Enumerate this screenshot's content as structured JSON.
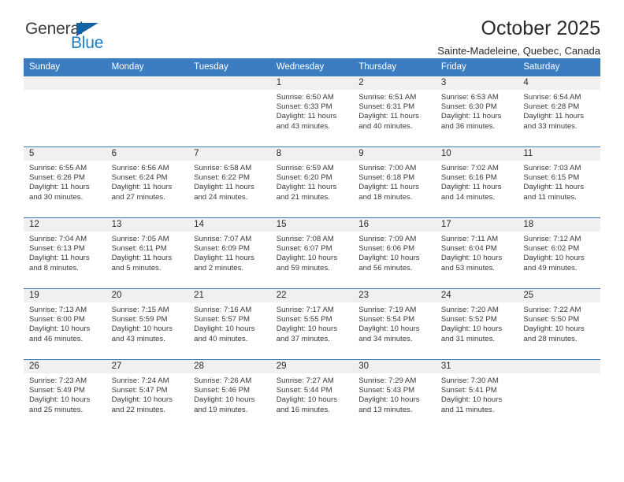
{
  "brand": {
    "name_part1": "General",
    "name_part2": "Blue",
    "color_dark": "#3d3d3d",
    "color_blue": "#1f7dc4"
  },
  "header": {
    "title": "October 2025",
    "subtitle": "Sainte-Madeleine, Quebec, Canada",
    "accent_color": "#3b7dc0"
  },
  "calendar": {
    "weekday_headers": [
      "Sunday",
      "Monday",
      "Tuesday",
      "Wednesday",
      "Thursday",
      "Friday",
      "Saturday"
    ],
    "weeks": [
      [
        {
          "day": "",
          "empty": true
        },
        {
          "day": "",
          "empty": true
        },
        {
          "day": "",
          "empty": true
        },
        {
          "day": "1",
          "sunrise": "Sunrise: 6:50 AM",
          "sunset": "Sunset: 6:33 PM",
          "daylight": "Daylight: 11 hours and 43 minutes."
        },
        {
          "day": "2",
          "sunrise": "Sunrise: 6:51 AM",
          "sunset": "Sunset: 6:31 PM",
          "daylight": "Daylight: 11 hours and 40 minutes."
        },
        {
          "day": "3",
          "sunrise": "Sunrise: 6:53 AM",
          "sunset": "Sunset: 6:30 PM",
          "daylight": "Daylight: 11 hours and 36 minutes."
        },
        {
          "day": "4",
          "sunrise": "Sunrise: 6:54 AM",
          "sunset": "Sunset: 6:28 PM",
          "daylight": "Daylight: 11 hours and 33 minutes."
        }
      ],
      [
        {
          "day": "5",
          "sunrise": "Sunrise: 6:55 AM",
          "sunset": "Sunset: 6:26 PM",
          "daylight": "Daylight: 11 hours and 30 minutes."
        },
        {
          "day": "6",
          "sunrise": "Sunrise: 6:56 AM",
          "sunset": "Sunset: 6:24 PM",
          "daylight": "Daylight: 11 hours and 27 minutes."
        },
        {
          "day": "7",
          "sunrise": "Sunrise: 6:58 AM",
          "sunset": "Sunset: 6:22 PM",
          "daylight": "Daylight: 11 hours and 24 minutes."
        },
        {
          "day": "8",
          "sunrise": "Sunrise: 6:59 AM",
          "sunset": "Sunset: 6:20 PM",
          "daylight": "Daylight: 11 hours and 21 minutes."
        },
        {
          "day": "9",
          "sunrise": "Sunrise: 7:00 AM",
          "sunset": "Sunset: 6:18 PM",
          "daylight": "Daylight: 11 hours and 18 minutes."
        },
        {
          "day": "10",
          "sunrise": "Sunrise: 7:02 AM",
          "sunset": "Sunset: 6:16 PM",
          "daylight": "Daylight: 11 hours and 14 minutes."
        },
        {
          "day": "11",
          "sunrise": "Sunrise: 7:03 AM",
          "sunset": "Sunset: 6:15 PM",
          "daylight": "Daylight: 11 hours and 11 minutes."
        }
      ],
      [
        {
          "day": "12",
          "sunrise": "Sunrise: 7:04 AM",
          "sunset": "Sunset: 6:13 PM",
          "daylight": "Daylight: 11 hours and 8 minutes."
        },
        {
          "day": "13",
          "sunrise": "Sunrise: 7:05 AM",
          "sunset": "Sunset: 6:11 PM",
          "daylight": "Daylight: 11 hours and 5 minutes."
        },
        {
          "day": "14",
          "sunrise": "Sunrise: 7:07 AM",
          "sunset": "Sunset: 6:09 PM",
          "daylight": "Daylight: 11 hours and 2 minutes."
        },
        {
          "day": "15",
          "sunrise": "Sunrise: 7:08 AM",
          "sunset": "Sunset: 6:07 PM",
          "daylight": "Daylight: 10 hours and 59 minutes."
        },
        {
          "day": "16",
          "sunrise": "Sunrise: 7:09 AM",
          "sunset": "Sunset: 6:06 PM",
          "daylight": "Daylight: 10 hours and 56 minutes."
        },
        {
          "day": "17",
          "sunrise": "Sunrise: 7:11 AM",
          "sunset": "Sunset: 6:04 PM",
          "daylight": "Daylight: 10 hours and 53 minutes."
        },
        {
          "day": "18",
          "sunrise": "Sunrise: 7:12 AM",
          "sunset": "Sunset: 6:02 PM",
          "daylight": "Daylight: 10 hours and 49 minutes."
        }
      ],
      [
        {
          "day": "19",
          "sunrise": "Sunrise: 7:13 AM",
          "sunset": "Sunset: 6:00 PM",
          "daylight": "Daylight: 10 hours and 46 minutes."
        },
        {
          "day": "20",
          "sunrise": "Sunrise: 7:15 AM",
          "sunset": "Sunset: 5:59 PM",
          "daylight": "Daylight: 10 hours and 43 minutes."
        },
        {
          "day": "21",
          "sunrise": "Sunrise: 7:16 AM",
          "sunset": "Sunset: 5:57 PM",
          "daylight": "Daylight: 10 hours and 40 minutes."
        },
        {
          "day": "22",
          "sunrise": "Sunrise: 7:17 AM",
          "sunset": "Sunset: 5:55 PM",
          "daylight": "Daylight: 10 hours and 37 minutes."
        },
        {
          "day": "23",
          "sunrise": "Sunrise: 7:19 AM",
          "sunset": "Sunset: 5:54 PM",
          "daylight": "Daylight: 10 hours and 34 minutes."
        },
        {
          "day": "24",
          "sunrise": "Sunrise: 7:20 AM",
          "sunset": "Sunset: 5:52 PM",
          "daylight": "Daylight: 10 hours and 31 minutes."
        },
        {
          "day": "25",
          "sunrise": "Sunrise: 7:22 AM",
          "sunset": "Sunset: 5:50 PM",
          "daylight": "Daylight: 10 hours and 28 minutes."
        }
      ],
      [
        {
          "day": "26",
          "sunrise": "Sunrise: 7:23 AM",
          "sunset": "Sunset: 5:49 PM",
          "daylight": "Daylight: 10 hours and 25 minutes."
        },
        {
          "day": "27",
          "sunrise": "Sunrise: 7:24 AM",
          "sunset": "Sunset: 5:47 PM",
          "daylight": "Daylight: 10 hours and 22 minutes."
        },
        {
          "day": "28",
          "sunrise": "Sunrise: 7:26 AM",
          "sunset": "Sunset: 5:46 PM",
          "daylight": "Daylight: 10 hours and 19 minutes."
        },
        {
          "day": "29",
          "sunrise": "Sunrise: 7:27 AM",
          "sunset": "Sunset: 5:44 PM",
          "daylight": "Daylight: 10 hours and 16 minutes."
        },
        {
          "day": "30",
          "sunrise": "Sunrise: 7:29 AM",
          "sunset": "Sunset: 5:43 PM",
          "daylight": "Daylight: 10 hours and 13 minutes."
        },
        {
          "day": "31",
          "sunrise": "Sunrise: 7:30 AM",
          "sunset": "Sunset: 5:41 PM",
          "daylight": "Daylight: 10 hours and 11 minutes."
        },
        {
          "day": "",
          "empty": true
        }
      ]
    ]
  }
}
